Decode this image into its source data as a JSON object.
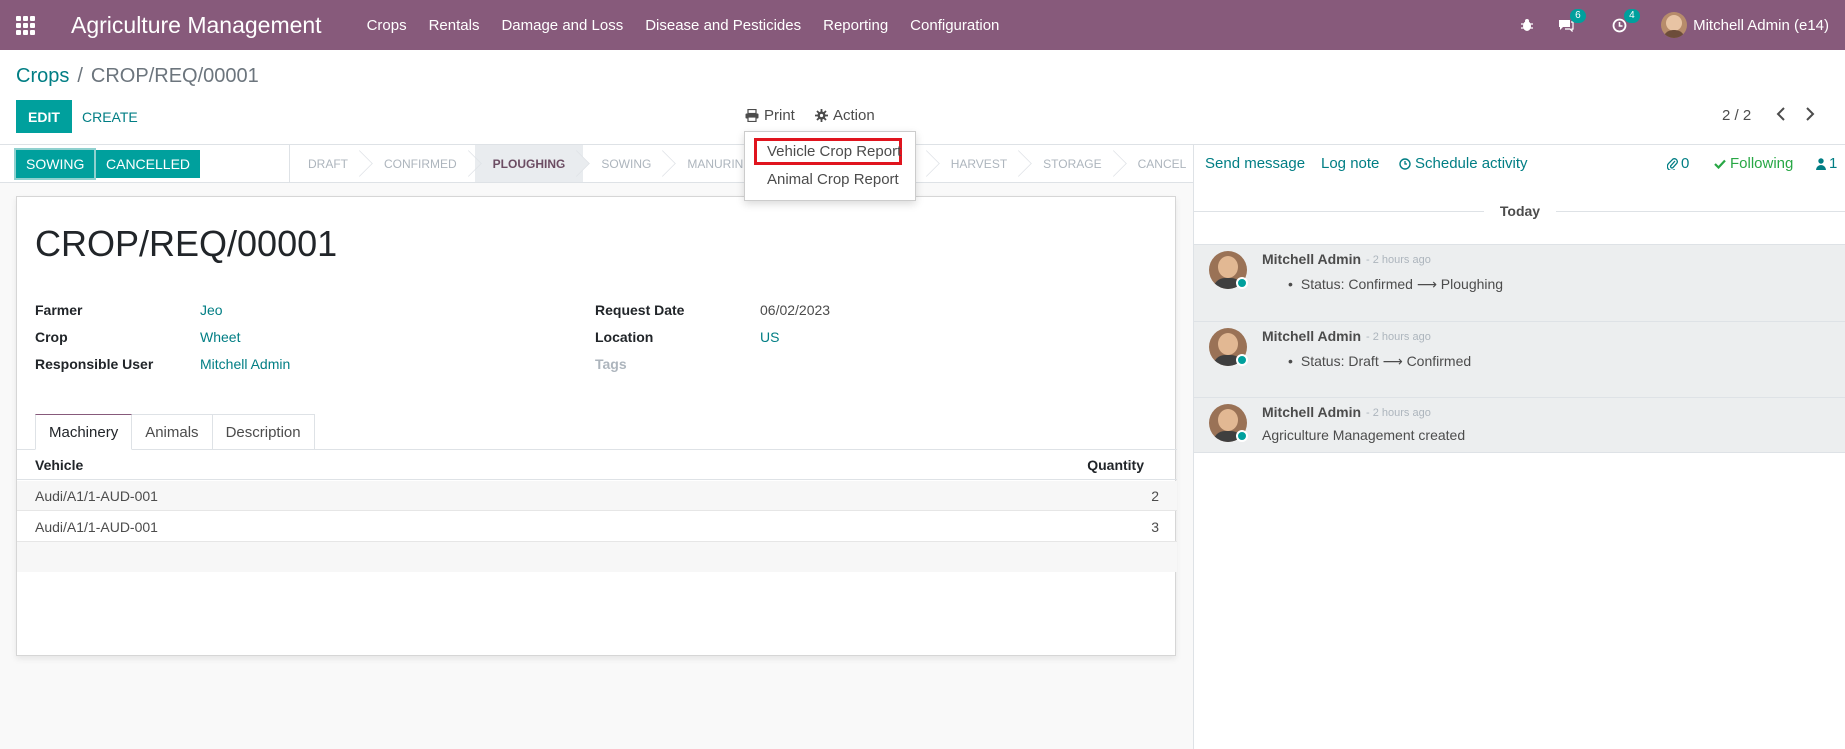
{
  "navbar": {
    "app_name": "Agriculture Management",
    "menu": [
      "Crops",
      "Rentals",
      "Damage and Loss",
      "Disease and Pesticides",
      "Reporting",
      "Configuration"
    ],
    "chat_badge": "6",
    "activity_badge": "4",
    "user_name": "Mitchell Admin (e14)"
  },
  "breadcrumb": {
    "parent": "Crops",
    "separator": "/",
    "current": "CROP/REQ/00001"
  },
  "toolbar": {
    "edit_label": "EDIT",
    "create_label": "CREATE",
    "print_label": "Print",
    "action_label": "Action",
    "pager": "2 / 2"
  },
  "print_menu": {
    "items": [
      "Vehicle Crop Report",
      "Animal Crop Report"
    ]
  },
  "status_buttons": {
    "sowing": "SOWING",
    "cancelled": "CANCELLED"
  },
  "stages": [
    "DRAFT",
    "CONFIRMED",
    "PLOUGHING",
    "SOWING",
    "MANURING",
    "",
    "",
    "HARVEST",
    "STORAGE",
    "CANCEL"
  ],
  "active_stage": "PLOUGHING",
  "form": {
    "title": "CROP/REQ/00001",
    "farmer_label": "Farmer",
    "farmer_value": "Jeo",
    "crop_label": "Crop",
    "crop_value": "Wheet",
    "responsible_label": "Responsible User",
    "responsible_value": "Mitchell Admin",
    "request_date_label": "Request Date",
    "request_date_value": "06/02/2023",
    "location_label": "Location",
    "location_value": "US",
    "tags_label": "Tags"
  },
  "tabs": [
    "Machinery",
    "Animals",
    "Description"
  ],
  "machinery": {
    "columns": [
      "Vehicle",
      "Quantity"
    ],
    "rows": [
      {
        "vehicle": "Audi/A1/1-AUD-001",
        "quantity": "2"
      },
      {
        "vehicle": "Audi/A1/1-AUD-001",
        "quantity": "3"
      }
    ]
  },
  "chatter": {
    "send_message": "Send message",
    "log_note": "Log note",
    "schedule_activity": "Schedule activity",
    "attachments": "0",
    "following": "Following",
    "followers": "1",
    "day_label": "Today",
    "messages": [
      {
        "author": "Mitchell Admin",
        "date": "- 2 hours ago",
        "body": "Status: Confirmed ⟶ Ploughing"
      },
      {
        "author": "Mitchell Admin",
        "date": "- 2 hours ago",
        "body": "Status: Draft ⟶ Confirmed"
      },
      {
        "author": "Mitchell Admin",
        "date": "- 2 hours ago",
        "body": "Agriculture Management created"
      }
    ]
  },
  "colors": {
    "navbar": "#875a7b",
    "primary": "#00a09d",
    "link": "#017e84",
    "highlight_box": "#e0141e"
  }
}
